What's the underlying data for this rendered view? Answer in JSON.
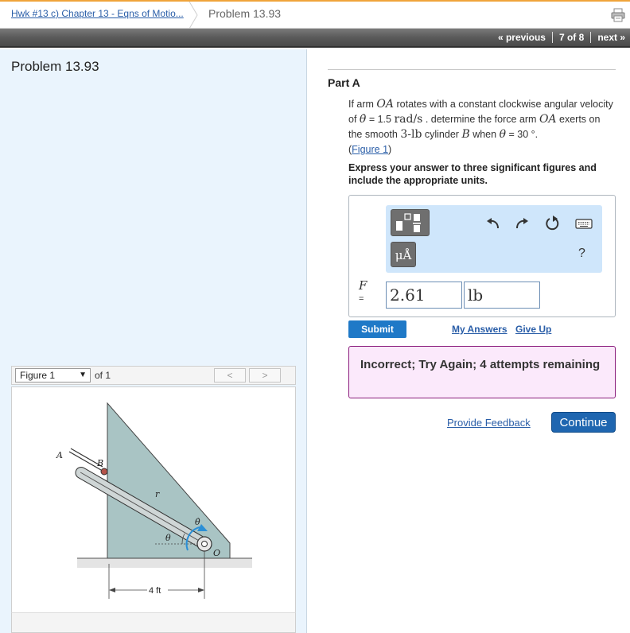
{
  "breadcrumb": {
    "assignment_link": "Hwk #13 c) Chapter 13 - Eqns of Motio...",
    "current": "Problem 13.93"
  },
  "nav": {
    "previous": "« previous",
    "position": "7 of 8",
    "next": "next »"
  },
  "left": {
    "problem_title": "Problem 13.93",
    "figure_select": "Figure 1",
    "figure_of": "of 1",
    "prev_arrow": "<",
    "next_arrow": ">"
  },
  "figure": {
    "label_A": "A",
    "label_B": "B",
    "label_r": "r",
    "label_theta": "θ",
    "label_thetadot": "θ̇",
    "label_O": "O",
    "dimension": "4 ft"
  },
  "part": {
    "title": "Part A",
    "q_if_arm": "If arm ",
    "q_OA1": "OA",
    "q_rotates": " rotates with a constant clockwise angular velocity of ",
    "q_thetadot": "θ̇",
    "q_eq1": " = 1.5 ",
    "q_units": "rad/s",
    "q_determine": " . determine the force arm ",
    "q_OA2": "OA",
    "q_exerts": " exerts on the smooth ",
    "q_mass": "3-lb",
    "q_cylinder": " cylinder ",
    "q_B": "B",
    "q_when": " when ",
    "q_theta": "θ",
    "q_eq2": " = 30 °.",
    "q_figure_link": "Figure 1",
    "instructions": "Express your answer to three significant figures and include the appropriate units."
  },
  "answer": {
    "units_button": "μÅ",
    "help": "?",
    "variable": "F",
    "equals": "=",
    "value": "2.61",
    "unit": "lb"
  },
  "actions": {
    "submit": "Submit",
    "my_answers": "My Answers",
    "give_up": "Give Up",
    "feedback": "Incorrect; Try Again; 4 attempts remaining",
    "provide_feedback": "Provide Feedback",
    "continue": "Continue"
  },
  "colors": {
    "accent": "#1f79c7",
    "toolbar_bg": "#cfe6fb",
    "feedback_bg": "#fbe9fb",
    "feedback_border": "#8a1c7c",
    "left_pane_bg": "#eaf4fd"
  }
}
